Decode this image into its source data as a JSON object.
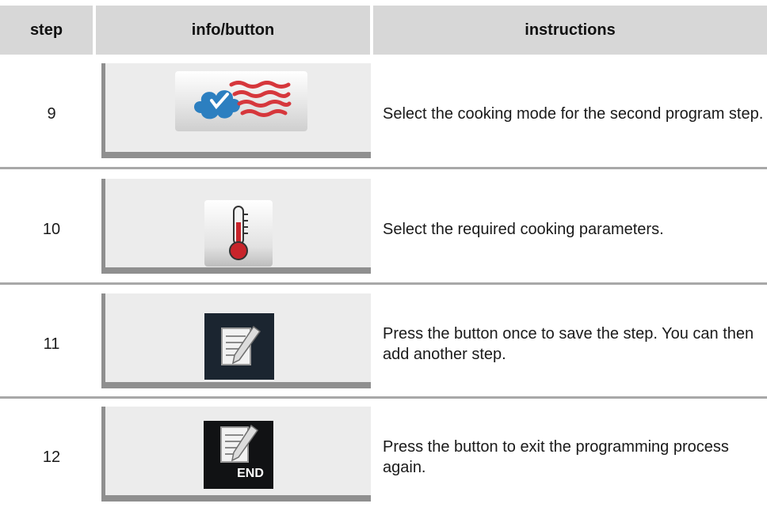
{
  "table": {
    "headers": {
      "step": "step",
      "info": "info/button",
      "instructions": "instructions"
    },
    "rows": [
      {
        "step": "9",
        "button_icon": "combi-steam-hot-air-icon",
        "instructions": "Select the cooking mode for the second program step."
      },
      {
        "step": "10",
        "button_icon": "thermometer-icon",
        "instructions": "Select the required cooking parameters."
      },
      {
        "step": "11",
        "button_icon": "save-step-notepad-icon",
        "instructions": "Press the button once to save the step. You can then add another step."
      },
      {
        "step": "12",
        "button_icon": "end-programming-notepad-icon",
        "button_label": "END",
        "instructions": "Press the button to exit the programming process again."
      }
    ]
  },
  "colors": {
    "header_bg": "#d7d7d7",
    "panel_bg": "#ececec",
    "panel_edge": "#8f8f8f",
    "separator": "#a8a8a8",
    "steam_blue": "#2c7fc0",
    "heat_red": "#d6373c"
  }
}
